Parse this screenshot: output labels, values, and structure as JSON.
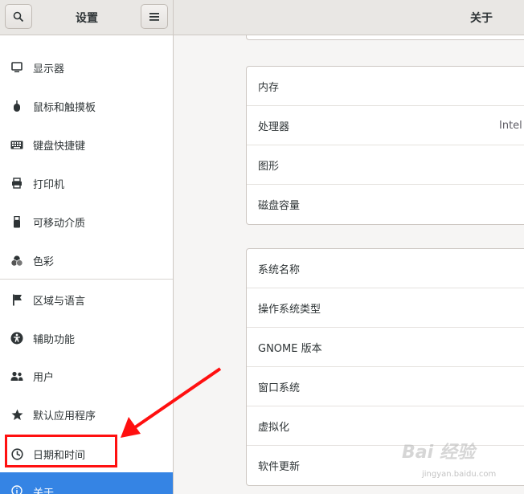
{
  "header": {
    "left_title": "设置",
    "right_title": "关于"
  },
  "sidebar": {
    "items": [
      {
        "label": "显示器",
        "icon": "display-icon"
      },
      {
        "label": "鼠标和触摸板",
        "icon": "mouse-icon"
      },
      {
        "label": "键盘快捷键",
        "icon": "keyboard-icon"
      },
      {
        "label": "打印机",
        "icon": "printer-icon"
      },
      {
        "label": "可移动介质",
        "icon": "removable-media-icon"
      },
      {
        "label": "色彩",
        "icon": "color-icon"
      },
      {
        "label": "区域与语言",
        "icon": "flag-icon"
      },
      {
        "label": "辅助功能",
        "icon": "accessibility-icon"
      },
      {
        "label": "用户",
        "icon": "users-icon"
      },
      {
        "label": "默认应用程序",
        "icon": "star-icon"
      },
      {
        "label": "日期和时间",
        "icon": "clock-icon"
      },
      {
        "label": "关于",
        "icon": "info-icon"
      }
    ]
  },
  "hardware_card": {
    "rows": [
      {
        "label": "内存",
        "value": ""
      },
      {
        "label": "处理器",
        "value": "Intel"
      },
      {
        "label": "图形",
        "value": ""
      },
      {
        "label": "磁盘容量",
        "value": ""
      }
    ]
  },
  "software_card": {
    "rows": [
      {
        "label": "系统名称",
        "value": ""
      },
      {
        "label": "操作系统类型",
        "value": ""
      },
      {
        "label": "GNOME 版本",
        "value": ""
      },
      {
        "label": "窗口系统",
        "value": ""
      },
      {
        "label": "虚拟化",
        "value": ""
      },
      {
        "label": "软件更新",
        "value": ""
      }
    ]
  },
  "watermark": {
    "text": "Bai 经验",
    "sub": "jingyan.baidu.com"
  },
  "colors": {
    "accent": "#3584e4",
    "annotation": "#ff1010"
  }
}
